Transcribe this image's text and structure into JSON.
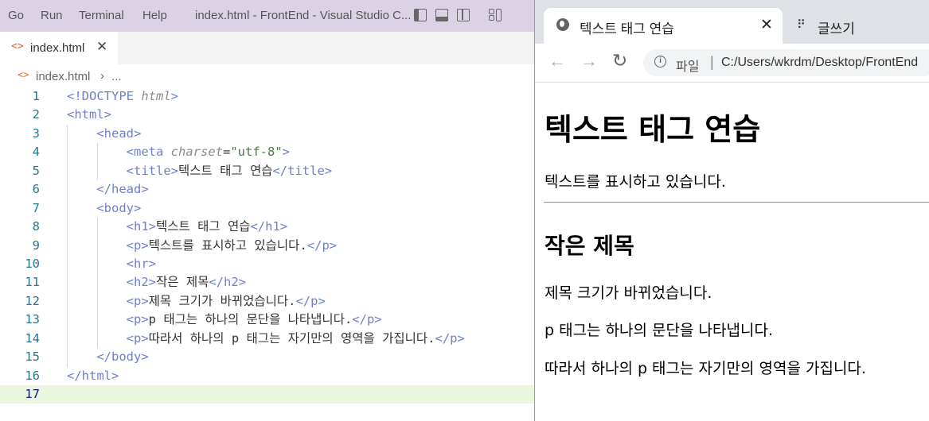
{
  "vscode": {
    "menu": [
      "Go",
      "Run",
      "Terminal",
      "Help"
    ],
    "window_title": "index.html - FrontEnd - Visual Studio C...",
    "tab": {
      "filename": "index.html",
      "close": "✕",
      "icon": "<>"
    },
    "breadcrumb": {
      "file": "index.html",
      "separator": "›",
      "more": "..."
    },
    "lines": [
      {
        "n": "1"
      },
      {
        "n": "2"
      },
      {
        "n": "3"
      },
      {
        "n": "4"
      },
      {
        "n": "5"
      },
      {
        "n": "6"
      },
      {
        "n": "7"
      },
      {
        "n": "8"
      },
      {
        "n": "9"
      },
      {
        "n": "10"
      },
      {
        "n": "11"
      },
      {
        "n": "12"
      },
      {
        "n": "13"
      },
      {
        "n": "14"
      },
      {
        "n": "15"
      },
      {
        "n": "16"
      },
      {
        "n": "17"
      }
    ],
    "code": {
      "doctype_kw": "<!DOCTYPE",
      "doctype_val": "html",
      "meta_attr": "charset",
      "meta_val": "\"utf-8\"",
      "title_text": "텍스트 태그 연습",
      "h1_text": "텍스트 태그 연습",
      "p1_text": "텍스트를 표시하고 있습니다.",
      "h2_text": "작은 제목",
      "p2_text": "제목 크기가 바뀌었습니다.",
      "p3_text": "p 태그는 하나의 문단을 나타냅니다.",
      "p4_text": "따라서 하나의 p 태그는 자기만의 영역을 가집니다."
    }
  },
  "chrome": {
    "tabs": [
      {
        "title": "텍스트 태그 연습",
        "icon": "globe-icon",
        "close": "✕"
      },
      {
        "title": "글쓰기",
        "icon": "dots-icon"
      }
    ],
    "omnibox": {
      "label": "파일",
      "separator": "|",
      "url": "C:/Users/wkrdm/Desktop/FrontEnd"
    },
    "page": {
      "h1": "텍스트 태그 연습",
      "p1": "텍스트를 표시하고 있습니다.",
      "h2": "작은 제목",
      "p2": "제목 크기가 바뀌었습니다.",
      "p3": "p 태그는 하나의 문단을 나타냅니다.",
      "p4": "따라서 하나의 p 태그는 자기만의 영역을 가집니다."
    }
  },
  "colors": {
    "titlebar": "#dcd2e6",
    "line_number": "#237893",
    "tag": "#6d7fcf",
    "string": "#43803c",
    "current_line": "#eaf6df"
  }
}
